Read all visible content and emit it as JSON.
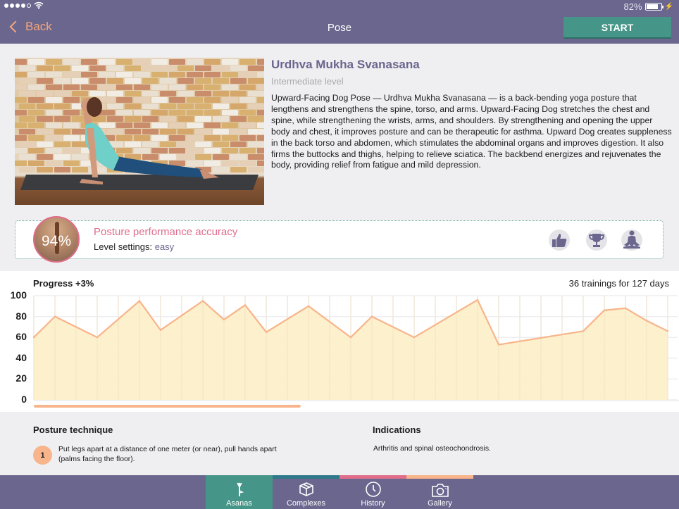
{
  "status_bar": {
    "signal_dots_filled": 4,
    "signal_dots_total": 5,
    "battery": "82%",
    "battery_level": 0.82
  },
  "nav": {
    "back_label": "Back",
    "title": "Pose",
    "start_label": "START"
  },
  "pose": {
    "name": "Urdhva Mukha Svanasana",
    "level": "Intermediate level",
    "description": "Upward-Facing Dog Pose — Urdhva Mukha Svanasana  — is a back-bending yoga posture that lengthens and strengthens the spine, torso, and arms. Upward-Facing Dog stretches the chest and spine, while strengthening the wrists, arms, and shoulders. By strengthening and opening the upper body and chest, it improves posture and can be therapeutic for asthma. Upward Dog creates suppleness in the back torso and abdomen, which stimulates the abdominal organs and improves digestion. It also firms the buttocks and thighs, helping to relieve sciatica. The backbend energizes and rejuvenates the body, providing relief from fatigue and mild depression.",
    "image_icon": "yoga-photo-upward-dog"
  },
  "accuracy": {
    "percent": "94%",
    "title": "Posture performance accuracy",
    "level_label": "Level settings: ",
    "level_value": "easy",
    "icons": [
      "thumbs-up-icon",
      "trophy-icon",
      "meditation-icon"
    ]
  },
  "progress": {
    "label": "Progress +3%",
    "summary": "36 trainings for 127 days",
    "scroll_position": 0.42
  },
  "chart_data": {
    "type": "area",
    "title": "Progress +3%",
    "xlabel": "",
    "ylabel": "",
    "ylim": [
      0,
      100
    ],
    "yticks": [
      "100",
      "80",
      "60",
      "40",
      "20",
      "0"
    ],
    "grid": true,
    "x_columns": 30,
    "x": [
      0,
      1,
      3,
      5,
      6,
      8,
      9,
      10,
      11,
      13,
      15,
      16,
      18,
      21,
      22,
      26,
      27,
      28,
      29,
      30
    ],
    "values": [
      60,
      80,
      60,
      95,
      67,
      95,
      77,
      91,
      65,
      90,
      60,
      80,
      60,
      96,
      53,
      66,
      86,
      88,
      76,
      66
    ],
    "line_color": "#f8b48a",
    "fill_color": "#fdeec8"
  },
  "technique": {
    "title": "Posture technique",
    "steps": [
      {
        "number": "1",
        "text": "Put legs apart at a distance of one meter (or near), pull hands apart (palms facing the floor)."
      }
    ]
  },
  "indications": {
    "title": "Indications",
    "text": "Arthritis and spinal osteochondrosis."
  },
  "tabs": [
    {
      "label": "Asanas",
      "icon": "yoga-tree-pose-icon",
      "active": true,
      "color": "#459688"
    },
    {
      "label": "Complexes",
      "icon": "box-icon",
      "active": false,
      "color": "#2f7a8a"
    },
    {
      "label": "History",
      "icon": "clock-icon",
      "active": false,
      "color": "#e06d8a"
    },
    {
      "label": "Gallery",
      "icon": "camera-icon",
      "active": false,
      "color": "#f8b48a"
    }
  ]
}
